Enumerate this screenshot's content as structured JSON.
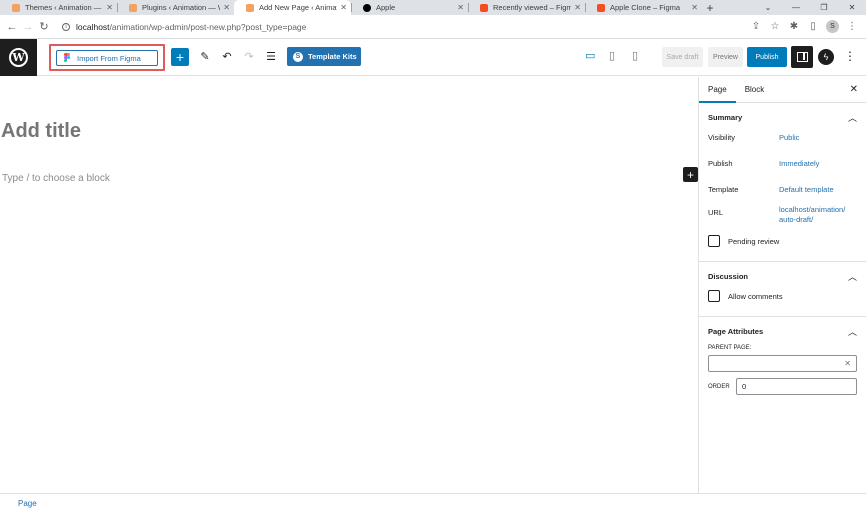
{
  "browser": {
    "tabs": [
      {
        "title": "Themes ‹ Animation — W",
        "favicon_color": "#f4a261",
        "active": false
      },
      {
        "title": "Plugins ‹ Animation — W",
        "favicon_color": "#f4a261",
        "active": false
      },
      {
        "title": "Add New Page ‹ Animat",
        "favicon_color": "#f4a261",
        "active": true
      },
      {
        "title": "Apple",
        "favicon_color": "#000000",
        "active": false
      },
      {
        "title": "Recently viewed – Figma",
        "favicon_color": "#f24e1e",
        "active": false
      },
      {
        "title": "Apple Clone – Figma",
        "favicon_color": "#f24e1e",
        "active": false
      }
    ],
    "url_host": "localhost",
    "url_path": "/animation/wp-admin/post-new.php?post_type=page",
    "profile_initial": "S"
  },
  "toolbar": {
    "import_figma_label": "Import From Figma",
    "template_kits_label": "Template Kits",
    "save_draft_label": "Save draft",
    "preview_label": "Preview",
    "publish_label": "Publish"
  },
  "editor": {
    "title_placeholder": "Add title",
    "block_placeholder": "Type / to choose a block"
  },
  "sidebar": {
    "tab_page": "Page",
    "tab_block": "Block",
    "summary": {
      "heading": "Summary",
      "visibility_label": "Visibility",
      "visibility_value": "Public",
      "publish_label": "Publish",
      "publish_value": "Immediately",
      "template_label": "Template",
      "template_value": "Default template",
      "url_label": "URL",
      "url_value_line1": "localhost/animation/",
      "url_value_line2": "auto-draft/",
      "pending_review_label": "Pending review"
    },
    "discussion": {
      "heading": "Discussion",
      "allow_comments_label": "Allow comments"
    },
    "page_attributes": {
      "heading": "Page Attributes",
      "parent_page_label": "PARENT PAGE:",
      "order_label": "ORDER",
      "order_value": "0"
    }
  },
  "footer": {
    "breadcrumb": "Page"
  },
  "colors": {
    "accent": "#007cba",
    "link": "#2271b1",
    "highlight_box": "#e05a5a"
  }
}
